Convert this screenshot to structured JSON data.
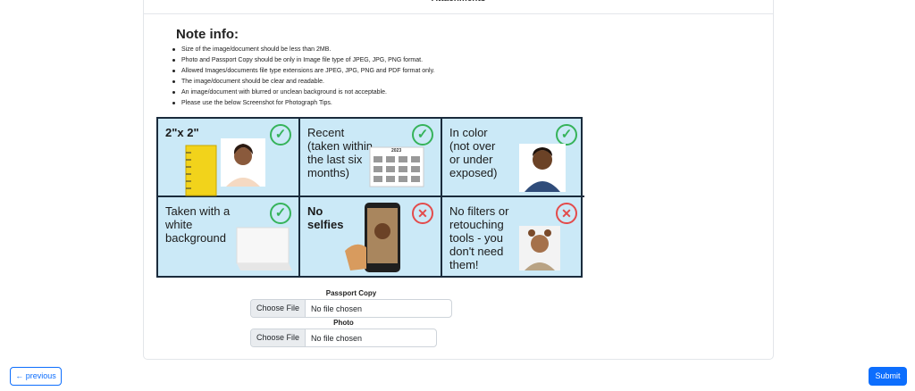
{
  "card": {
    "header_title": "Attachments",
    "note_title": "Note info:",
    "notes": [
      "Size of the image/document should be less than 2MB.",
      "Photo and Passport Copy should be only in Image file type of JPEG, JPG, PNG format.",
      "Allowed Images/documents file type extensions are JPEG, JPG, PNG and PDF format only.",
      "The image/document should be clear and readable.",
      "An image/document with blurred or unclean background is not acceptable.",
      "Please use the below Screenshot for Photograph Tips."
    ]
  },
  "tips": [
    {
      "text": "2\"x 2\"",
      "status": "ok"
    },
    {
      "text": "Recent (taken within the last six months)",
      "status": "ok"
    },
    {
      "text": "In color (not over or under exposed)",
      "status": "ok"
    },
    {
      "text": "Taken with a white background",
      "status": "ok"
    },
    {
      "text": "No selfies",
      "status": "no"
    },
    {
      "text": "No filters or retouching tools - you don't need them!",
      "status": "no"
    }
  ],
  "calendar_year": "2023",
  "uploads": {
    "passport_label": "Passport Copy",
    "photo_label": "Photo",
    "choose_label": "Choose File",
    "no_file_text": "No file chosen"
  },
  "nav": {
    "previous_label": "← previous",
    "submit_label": "Submit"
  },
  "colors": {
    "primary": "#0d6efd",
    "check": "#36b35a",
    "cross": "#e34b4b",
    "tips_bg": "#cbe9f7"
  }
}
